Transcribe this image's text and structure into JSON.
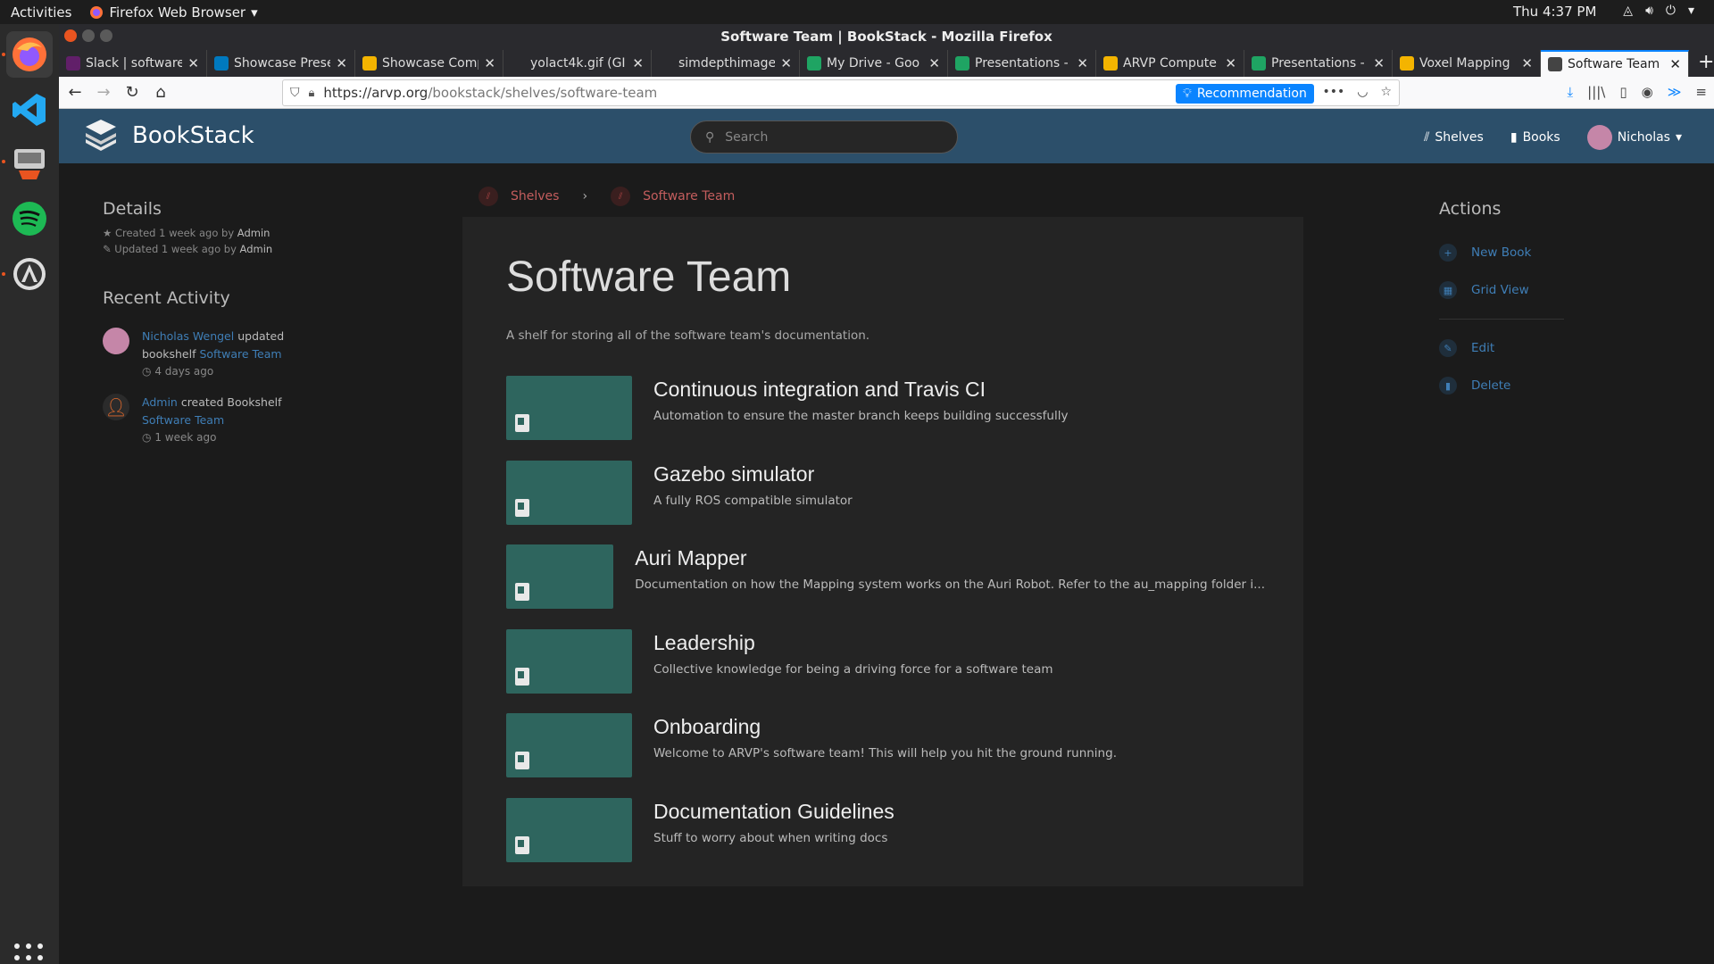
{
  "topbar": {
    "activities": "Activities",
    "app_name": "Firefox Web Browser",
    "clock": "Thu  4:37 PM"
  },
  "window": {
    "title": "Software Team | BookStack - Mozilla Firefox"
  },
  "tabs": [
    {
      "label": "Slack | software",
      "icon": "slack-icon",
      "color": "#611f69"
    },
    {
      "label": "Showcase Prese",
      "icon": "trello-icon",
      "color": "#0079bf"
    },
    {
      "label": "Showcase Comp",
      "icon": "slides-icon",
      "color": "#f4b400"
    },
    {
      "label": "yolact4k.gif (GIF Im",
      "icon": "none",
      "color": "#2a2a2e"
    },
    {
      "label": "simdepthimage.pn",
      "icon": "none",
      "color": "#2a2a2e"
    },
    {
      "label": "My Drive - Goo",
      "icon": "drive-icon",
      "color": "#1fa463"
    },
    {
      "label": "Presentations -",
      "icon": "drive-icon",
      "color": "#1fa463"
    },
    {
      "label": "ARVP Compute",
      "icon": "slides-icon",
      "color": "#f4b400"
    },
    {
      "label": "Presentations -",
      "icon": "drive-icon",
      "color": "#1fa463"
    },
    {
      "label": "Voxel Mapping",
      "icon": "slides-icon",
      "color": "#f4b400"
    },
    {
      "label": "Software Team",
      "icon": "bookstack-icon",
      "color": "#444444",
      "active": true
    }
  ],
  "urlbar": {
    "url_domain": "https://arvp.org",
    "url_path": "/bookstack/shelves/software-team",
    "recommendation": "Recommendation"
  },
  "bookstack": {
    "app_name": "BookStack",
    "search_placeholder": "Search",
    "nav_shelves": "Shelves",
    "nav_books": "Books",
    "user_name": "Nicholas"
  },
  "breadcrumbs": {
    "shelves": "Shelves",
    "current": "Software Team"
  },
  "details": {
    "heading": "Details",
    "created": "Created 1 week ago by",
    "created_by": "Admin",
    "updated": "Updated 1 week ago by",
    "updated_by": "Admin"
  },
  "recent_activity": {
    "heading": "Recent Activity",
    "items": [
      {
        "user": "Nicholas Wengel",
        "action": " updated bookshelf ",
        "target": "Software Team",
        "time": "4 days ago"
      },
      {
        "user": "Admin",
        "action": " created Bookshelf ",
        "target": "Software Team",
        "time": "1 week ago"
      }
    ]
  },
  "shelf": {
    "title": "Software Team",
    "description": "A shelf for storing all of the software team's documentation.",
    "books": [
      {
        "title": "Continuous integration and Travis CI",
        "desc": "Automation to ensure the master branch keeps building successfully"
      },
      {
        "title": "Gazebo simulator",
        "desc": "A fully ROS compatible simulator"
      },
      {
        "title": "Auri Mapper",
        "desc": "Documentation on how the Mapping system works on the Auri Robot. Refer to the au_mapping folder i..."
      },
      {
        "title": "Leadership",
        "desc": "Collective knowledge for being a driving force for a software team"
      },
      {
        "title": "Onboarding",
        "desc": "Welcome to ARVP's software team! This will help you hit the ground running."
      },
      {
        "title": "Documentation Guidelines",
        "desc": "Stuff to worry about when writing docs"
      }
    ]
  },
  "actions": {
    "heading": "Actions",
    "new_book": "New Book",
    "grid_view": "Grid View",
    "edit": "Edit",
    "delete": "Delete"
  },
  "colors": {
    "header_bg": "#2c4f6a",
    "book_cover": "#2e655e",
    "link": "#3f7eb6",
    "breadcrumb": "#c35d5d"
  }
}
